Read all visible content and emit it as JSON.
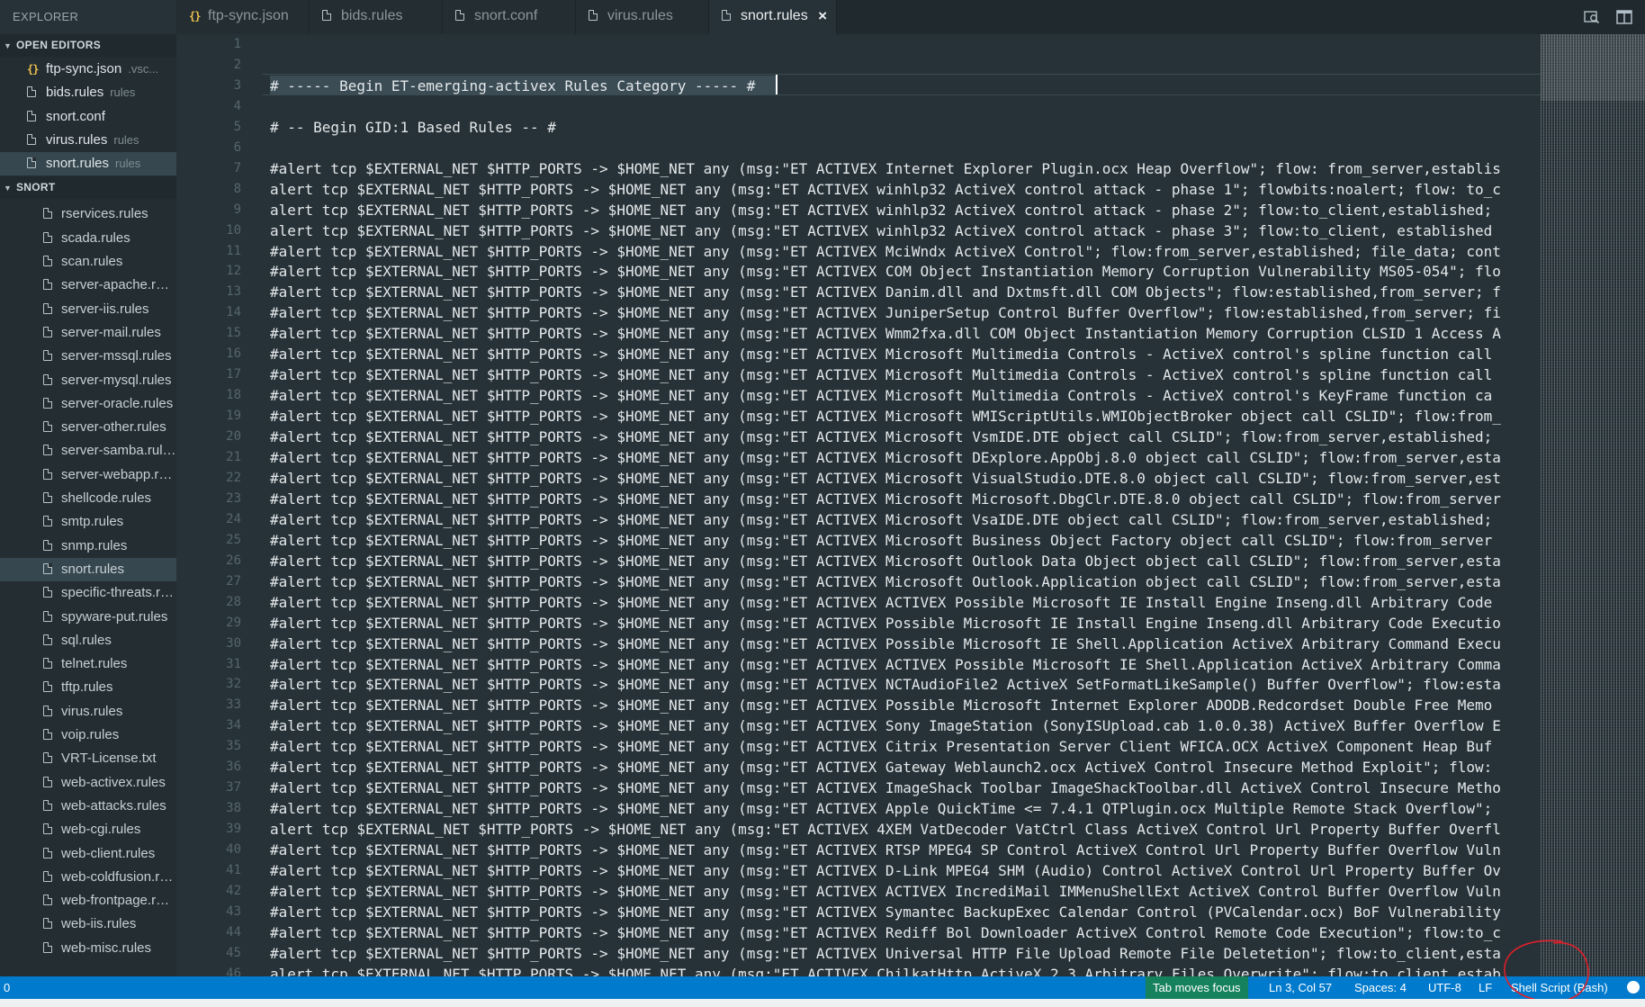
{
  "sidebar": {
    "title": "EXPLORER",
    "open_editors": {
      "header": "OPEN EDITORS",
      "items": [
        {
          "name": "ftp-sync.json",
          "detail": ".vsc...",
          "icon": "json-braces-icon"
        },
        {
          "name": "bids.rules",
          "detail": "rules",
          "icon": "file-icon"
        },
        {
          "name": "snort.conf",
          "detail": "",
          "icon": "file-icon"
        },
        {
          "name": "virus.rules",
          "detail": "rules",
          "icon": "file-icon"
        },
        {
          "name": "snort.rules",
          "detail": "rules",
          "icon": "file-icon",
          "active": true
        }
      ]
    },
    "folder": {
      "header": "SNORT",
      "items": [
        "rservices.rules",
        "scada.rules",
        "scan.rules",
        "server-apache.rules",
        "server-iis.rules",
        "server-mail.rules",
        "server-mssql.rules",
        "server-mysql.rules",
        "server-oracle.rules",
        "server-other.rules",
        "server-samba.rules",
        "server-webapp.rules",
        "shellcode.rules",
        "smtp.rules",
        "snmp.rules",
        "snort.rules",
        "specific-threats.rules",
        "spyware-put.rules",
        "sql.rules",
        "telnet.rules",
        "tftp.rules",
        "virus.rules",
        "voip.rules",
        "VRT-License.txt",
        "web-activex.rules",
        "web-attacks.rules",
        "web-cgi.rules",
        "web-client.rules",
        "web-coldfusion.rules",
        "web-frontpage.rules",
        "web-iis.rules",
        "web-misc.rules"
      ],
      "active": "snort.rules"
    }
  },
  "tabs": [
    {
      "label": "ftp-sync.json",
      "icon": "json-braces-icon"
    },
    {
      "label": "bids.rules",
      "icon": "file-icon"
    },
    {
      "label": "snort.conf",
      "icon": "file-icon"
    },
    {
      "label": "virus.rules",
      "icon": "file-icon"
    },
    {
      "label": "snort.rules",
      "icon": "file-icon",
      "active": true,
      "close": "×"
    }
  ],
  "tab_actions": [
    "open-changes-icon",
    "split-editor-icon"
  ],
  "editor": {
    "lines": [
      "",
      "",
      "# ----- Begin ET-emerging-activex Rules Category ----- #",
      "",
      "# -- Begin GID:1 Based Rules -- #",
      "",
      "#alert tcp $EXTERNAL_NET $HTTP_PORTS -> $HOME_NET any (msg:\"ET ACTIVEX Internet Explorer Plugin.ocx Heap Overflow\"; flow: from_server,establis",
      "alert tcp $EXTERNAL_NET $HTTP_PORTS -> $HOME_NET any (msg:\"ET ACTIVEX winhlp32 ActiveX control attack - phase 1\"; flowbits:noalert; flow: to_c",
      "alert tcp $EXTERNAL_NET $HTTP_PORTS -> $HOME_NET any (msg:\"ET ACTIVEX winhlp32 ActiveX control attack - phase 2\"; flow:to_client,established;",
      "alert tcp $EXTERNAL_NET $HTTP_PORTS -> $HOME_NET any (msg:\"ET ACTIVEX winhlp32 ActiveX control attack - phase 3\"; flow:to_client, established",
      "#alert tcp $EXTERNAL_NET $HTTP_PORTS -> $HOME_NET any (msg:\"ET ACTIVEX MciWndx ActiveX Control\"; flow:from_server,established; file_data; cont",
      "#alert tcp $EXTERNAL_NET $HTTP_PORTS -> $HOME_NET any (msg:\"ET ACTIVEX COM Object Instantiation Memory Corruption Vulnerability MS05-054\"; flo",
      "#alert tcp $EXTERNAL_NET $HTTP_PORTS -> $HOME_NET any (msg:\"ET ACTIVEX Danim.dll and Dxtmsft.dll COM Objects\"; flow:established,from_server; f",
      "#alert tcp $EXTERNAL_NET $HTTP_PORTS -> $HOME_NET any (msg:\"ET ACTIVEX JuniperSetup Control Buffer Overflow\"; flow:established,from_server; fi",
      "#alert tcp $EXTERNAL_NET $HTTP_PORTS -> $HOME_NET any (msg:\"ET ACTIVEX Wmm2fxa.dll COM Object Instantiation Memory Corruption CLSID 1 Access A",
      "#alert tcp $EXTERNAL_NET $HTTP_PORTS -> $HOME_NET any (msg:\"ET ACTIVEX Microsoft Multimedia Controls - ActiveX control's spline function call",
      "#alert tcp $EXTERNAL_NET $HTTP_PORTS -> $HOME_NET any (msg:\"ET ACTIVEX Microsoft Multimedia Controls - ActiveX control's spline function call",
      "#alert tcp $EXTERNAL_NET $HTTP_PORTS -> $HOME_NET any (msg:\"ET ACTIVEX Microsoft Multimedia Controls - ActiveX control's KeyFrame function ca",
      "#alert tcp $EXTERNAL_NET $HTTP_PORTS -> $HOME_NET any (msg:\"ET ACTIVEX Microsoft WMIScriptUtils.WMIObjectBroker object call CSLID\"; flow:from_",
      "#alert tcp $EXTERNAL_NET $HTTP_PORTS -> $HOME_NET any (msg:\"ET ACTIVEX Microsoft VsmIDE.DTE object call CSLID\"; flow:from_server,established;",
      "#alert tcp $EXTERNAL_NET $HTTP_PORTS -> $HOME_NET any (msg:\"ET ACTIVEX Microsoft DExplore.AppObj.8.0 object call CSLID\"; flow:from_server,esta",
      "#alert tcp $EXTERNAL_NET $HTTP_PORTS -> $HOME_NET any (msg:\"ET ACTIVEX Microsoft VisualStudio.DTE.8.0 object call CSLID\"; flow:from_server,est",
      "#alert tcp $EXTERNAL_NET $HTTP_PORTS -> $HOME_NET any (msg:\"ET ACTIVEX Microsoft Microsoft.DbgClr.DTE.8.0 object call CSLID\"; flow:from_server",
      "#alert tcp $EXTERNAL_NET $HTTP_PORTS -> $HOME_NET any (msg:\"ET ACTIVEX Microsoft VsaIDE.DTE object call CSLID\"; flow:from_server,established;",
      "#alert tcp $EXTERNAL_NET $HTTP_PORTS -> $HOME_NET any (msg:\"ET ACTIVEX Microsoft Business Object Factory object call CSLID\"; flow:from_server",
      "#alert tcp $EXTERNAL_NET $HTTP_PORTS -> $HOME_NET any (msg:\"ET ACTIVEX Microsoft Outlook Data Object object call CSLID\"; flow:from_server,esta",
      "#alert tcp $EXTERNAL_NET $HTTP_PORTS -> $HOME_NET any (msg:\"ET ACTIVEX Microsoft Outlook.Application object call CSLID\"; flow:from_server,esta",
      "#alert tcp $EXTERNAL_NET $HTTP_PORTS -> $HOME_NET any (msg:\"ET ACTIVEX ACTIVEX Possible Microsoft IE Install Engine Inseng.dll Arbitrary Code",
      "#alert tcp $EXTERNAL_NET $HTTP_PORTS -> $HOME_NET any (msg:\"ET ACTIVEX Possible Microsoft IE Install Engine Inseng.dll Arbitrary Code Executio",
      "#alert tcp $EXTERNAL_NET $HTTP_PORTS -> $HOME_NET any (msg:\"ET ACTIVEX Possible Microsoft IE Shell.Application ActiveX Arbitrary Command Execu",
      "#alert tcp $EXTERNAL_NET $HTTP_PORTS -> $HOME_NET any (msg:\"ET ACTIVEX ACTIVEX Possible Microsoft IE Shell.Application ActiveX Arbitrary Comma",
      "#alert tcp $EXTERNAL_NET $HTTP_PORTS -> $HOME_NET any (msg:\"ET ACTIVEX NCTAudioFile2 ActiveX SetFormatLikeSample() Buffer Overflow\"; flow:esta",
      "#alert tcp $EXTERNAL_NET $HTTP_PORTS -> $HOME_NET any (msg:\"ET ACTIVEX Possible Microsoft Internet Explorer ADODB.Redcordset Double Free Memo",
      "#alert tcp $EXTERNAL_NET $HTTP_PORTS -> $HOME_NET any (msg:\"ET ACTIVEX Sony ImageStation (SonyISUpload.cab 1.0.0.38) ActiveX Buffer Overflow E",
      "#alert tcp $EXTERNAL_NET $HTTP_PORTS -> $HOME_NET any (msg:\"ET ACTIVEX Citrix Presentation Server Client WFICA.OCX ActiveX Component Heap Buf",
      "#alert tcp $EXTERNAL_NET $HTTP_PORTS -> $HOME_NET any (msg:\"ET ACTIVEX Gateway Weblaunch2.ocx ActiveX Control Insecure Method Exploit\"; flow:",
      "#alert tcp $EXTERNAL_NET $HTTP_PORTS -> $HOME_NET any (msg:\"ET ACTIVEX ImageShack Toolbar ImageShackToolbar.dll ActiveX Control Insecure Metho",
      "#alert tcp $EXTERNAL_NET $HTTP_PORTS -> $HOME_NET any (msg:\"ET ACTIVEX Apple QuickTime <= 7.4.1 QTPlugin.ocx Multiple Remote Stack Overflow\";",
      "alert tcp $EXTERNAL_NET $HTTP_PORTS -> $HOME_NET any (msg:\"ET ACTIVEX 4XEM VatDecoder VatCtrl Class ActiveX Control Url Property Buffer Overfl",
      "#alert tcp $EXTERNAL_NET $HTTP_PORTS -> $HOME_NET any (msg:\"ET ACTIVEX RTSP MPEG4 SP Control ActiveX Control Url Property Buffer Overflow Vuln",
      "#alert tcp $EXTERNAL_NET $HTTP_PORTS -> $HOME_NET any (msg:\"ET ACTIVEX D-Link MPEG4 SHM (Audio) Control ActiveX Control Url Property Buffer Ov",
      "#alert tcp $EXTERNAL_NET $HTTP_PORTS -> $HOME_NET any (msg:\"ET ACTIVEX ACTIVEX IncrediMail IMMenuShellExt ActiveX Control Buffer Overflow Vuln",
      "#alert tcp $EXTERNAL_NET $HTTP_PORTS -> $HOME_NET any (msg:\"ET ACTIVEX Symantec BackupExec Calendar Control (PVCalendar.ocx) BoF Vulnerability",
      "#alert tcp $EXTERNAL_NET $HTTP_PORTS -> $HOME_NET any (msg:\"ET ACTIVEX Rediff Bol Downloader ActiveX Control Remote Code Execution\"; flow:to_c",
      "#alert tcp $EXTERNAL_NET $HTTP_PORTS -> $HOME_NET any (msg:\"ET ACTIVEX Universal HTTP File Upload Remote File Deletetion\"; flow:to_client,esta",
      "alert tcp $EXTERNAL_NET $HTTP_PORTS -> $HOME_NET any (msg:\"ET ACTIVEX ChilkatHttp ActiveX 2.3 Arbitrary Files Overwrite\"; flow:to_client,estab"
    ]
  },
  "statusbar": {
    "left": "0",
    "tab_moves_focus": "Tab moves focus",
    "position": "Ln 3, Col 57",
    "indent": "Spaces: 4",
    "encoding": "UTF-8",
    "eol": "LF",
    "language": "Shell Script (Bash)",
    "feedback_icon": "smiley-icon",
    "colors": {
      "background": "#007acc",
      "tab_focus": "#16825d"
    }
  },
  "annotation": {
    "color": "#e0202a",
    "shape": "hand-drawn-circle"
  }
}
